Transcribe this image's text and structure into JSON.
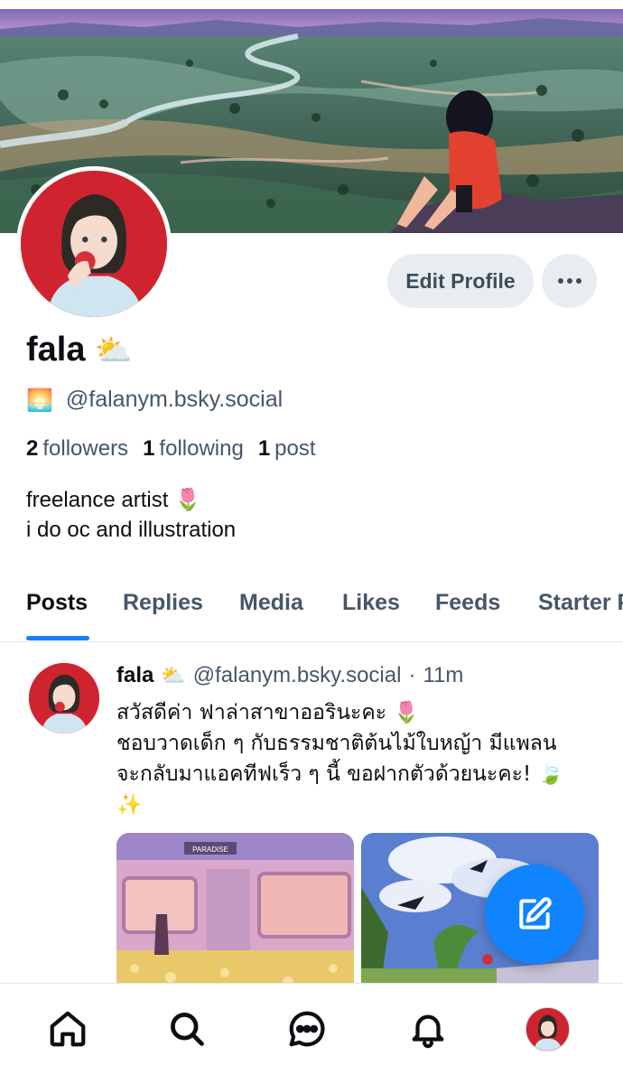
{
  "profile": {
    "display_name": "fala",
    "name_emoji": "⛅",
    "handle_emoji": "🌅",
    "handle": "@falanym.bsky.social",
    "followers_count": "2",
    "followers_label": "followers",
    "following_count": "1",
    "following_label": "following",
    "posts_count": "1",
    "posts_label": "post",
    "bio_line1": "freelance artist 🌷",
    "bio_line2": "i do oc and illustration"
  },
  "actions": {
    "edit_profile": "Edit Profile",
    "more": "···"
  },
  "tabs": [
    {
      "label": "Posts",
      "active": true
    },
    {
      "label": "Replies",
      "active": false
    },
    {
      "label": "Media",
      "active": false
    },
    {
      "label": "Likes",
      "active": false
    },
    {
      "label": "Feeds",
      "active": false
    },
    {
      "label": "Starter P",
      "active": false
    }
  ],
  "post": {
    "author": "fala",
    "author_emoji": "⛅",
    "handle": "@falanym.bsky.social",
    "separator": "·",
    "time": "11m",
    "text_line1": "สวัสดีค่า ฟาล่าสาขาออรินะคะ 🌷",
    "text_line2": "ชอบวาดเด็ก ๆ กับธรรมชาติต้นไม้ใบหญ้า มีแพลน",
    "text_line3": "จะกลับมาแอคทีฟเร็ว ๆ นี้ ขอฝากตัวด้วยนะคะ! 🍃",
    "text_line4": "✨",
    "image1_sign": "PARADISE"
  },
  "nav": {
    "items": [
      "home-icon",
      "search-icon",
      "chat-icon",
      "bell-icon",
      "profile-avatar"
    ]
  },
  "colors": {
    "accent": "#1083fe",
    "muted_text": "#46566a",
    "button_bg": "#e9edf2"
  }
}
